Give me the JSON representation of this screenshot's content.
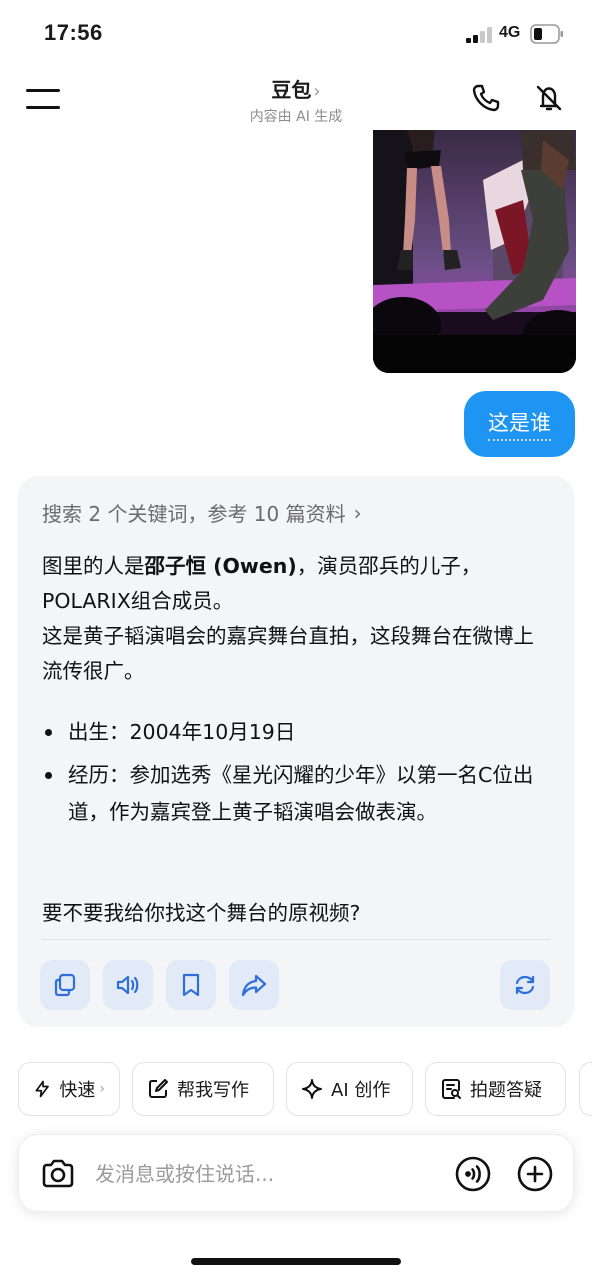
{
  "status_bar": {
    "time": "17:56",
    "network": "4G"
  },
  "header": {
    "title": "豆包",
    "subtitle": "内容由 AI 生成"
  },
  "user_message": {
    "text": "这是谁"
  },
  "answer": {
    "search_summary": "搜索 2 个关键词，参考 10 篇资料",
    "para1_prefix": "图里的人是",
    "para1_bold": "邵子恒 (Owen)",
    "para1_suffix": "，演员邵兵的儿子，POLARIX组合成员。",
    "para2": "这是黄子韬演唱会的嘉宾舞台直拍，这段舞台在微博上流传很广。",
    "bullets": [
      "出生：2004年10月19日",
      "经历：参加选秀《星光闪耀的少年》以第一名C位出道，作为嘉宾登上黄子韬演唱会做表演。"
    ],
    "question": "要不要我给你找这个舞台的原视频?",
    "actions": [
      "copy-icon",
      "speaker-icon",
      "bookmark-icon",
      "share-icon",
      "regenerate-icon"
    ]
  },
  "chips": [
    {
      "label": "快速",
      "icon": "lightning-icon"
    },
    {
      "label": "帮我写作",
      "icon": "edit-icon"
    },
    {
      "label": "AI 创作",
      "icon": "sparkle-icon"
    },
    {
      "label": "拍题答疑",
      "icon": "scan-question-icon"
    }
  ],
  "input": {
    "placeholder": "发消息或按住说话..."
  },
  "colors": {
    "accent": "#1e95f2",
    "card_bg": "#f4f5f7",
    "action_bg": "#e3eaf7",
    "icon_blue": "#2f6fdc"
  }
}
